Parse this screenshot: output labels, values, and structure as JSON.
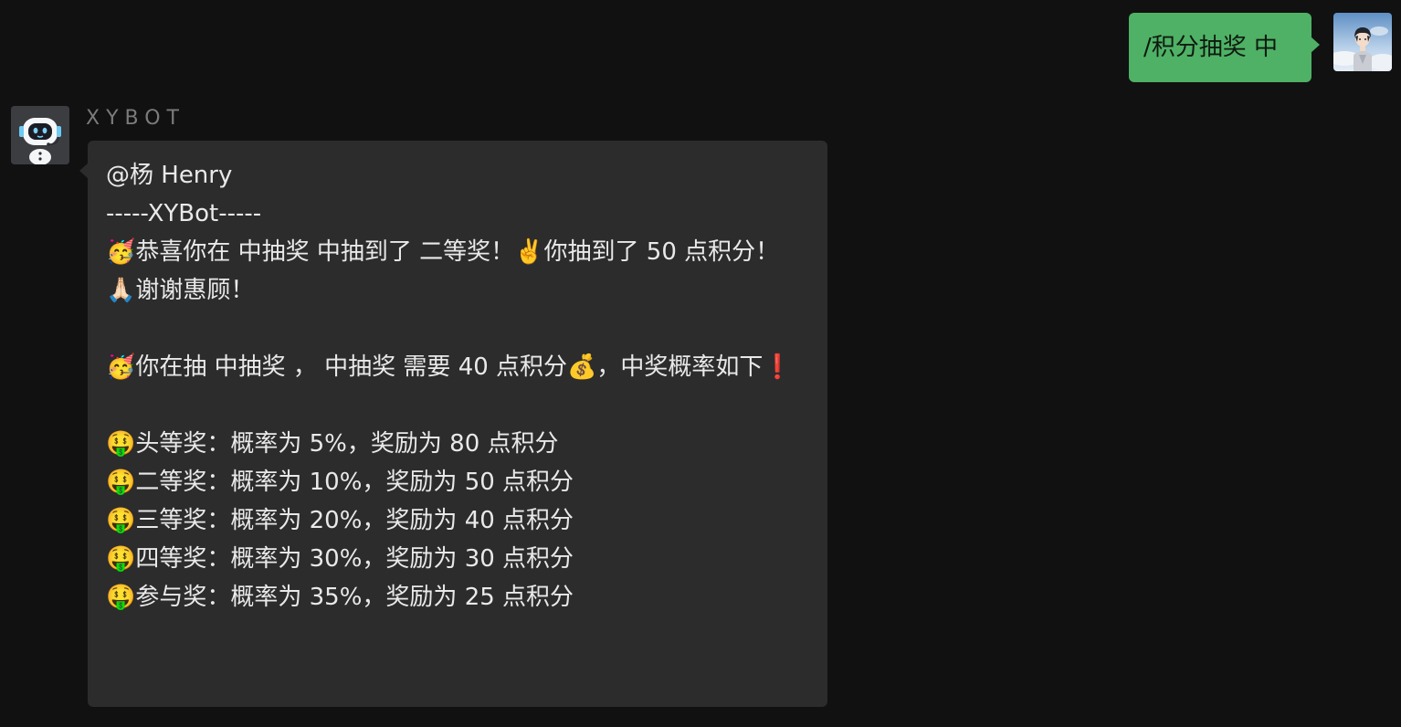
{
  "outgoing": {
    "text": "/积分抽奖 中"
  },
  "incoming": {
    "sender": "XYBOT",
    "lines": [
      "@杨 Henry",
      "-----XYBot-----",
      "🥳恭喜你在 中抽奖 中抽到了 二等奖！✌️你抽到了 50 点积分！",
      "🙏🏻谢谢惠顾！",
      "",
      "🥳你在抽 中抽奖 ， 中抽奖 需要 40 点积分💰，中奖概率如下❗",
      "",
      "🤑头等奖：概率为 5%，奖励为 80 点积分",
      "🤑二等奖：概率为 10%，奖励为 50 点积分",
      "🤑三等奖：概率为 20%，奖励为 40 点积分",
      "🤑四等奖：概率为 30%，奖励为 30 点积分",
      "🤑参与奖：概率为 35%，奖励为 25 点积分"
    ]
  },
  "icons": {
    "user_avatar": "user-avatar-anime-boy",
    "bot_avatar": "robot-icon"
  },
  "colors": {
    "background": "#111111",
    "outgoing_bubble": "#4fb165",
    "incoming_bubble": "#2c2c2c",
    "sender_name": "#7b7b7b",
    "message_text": "#e9e9e9"
  }
}
